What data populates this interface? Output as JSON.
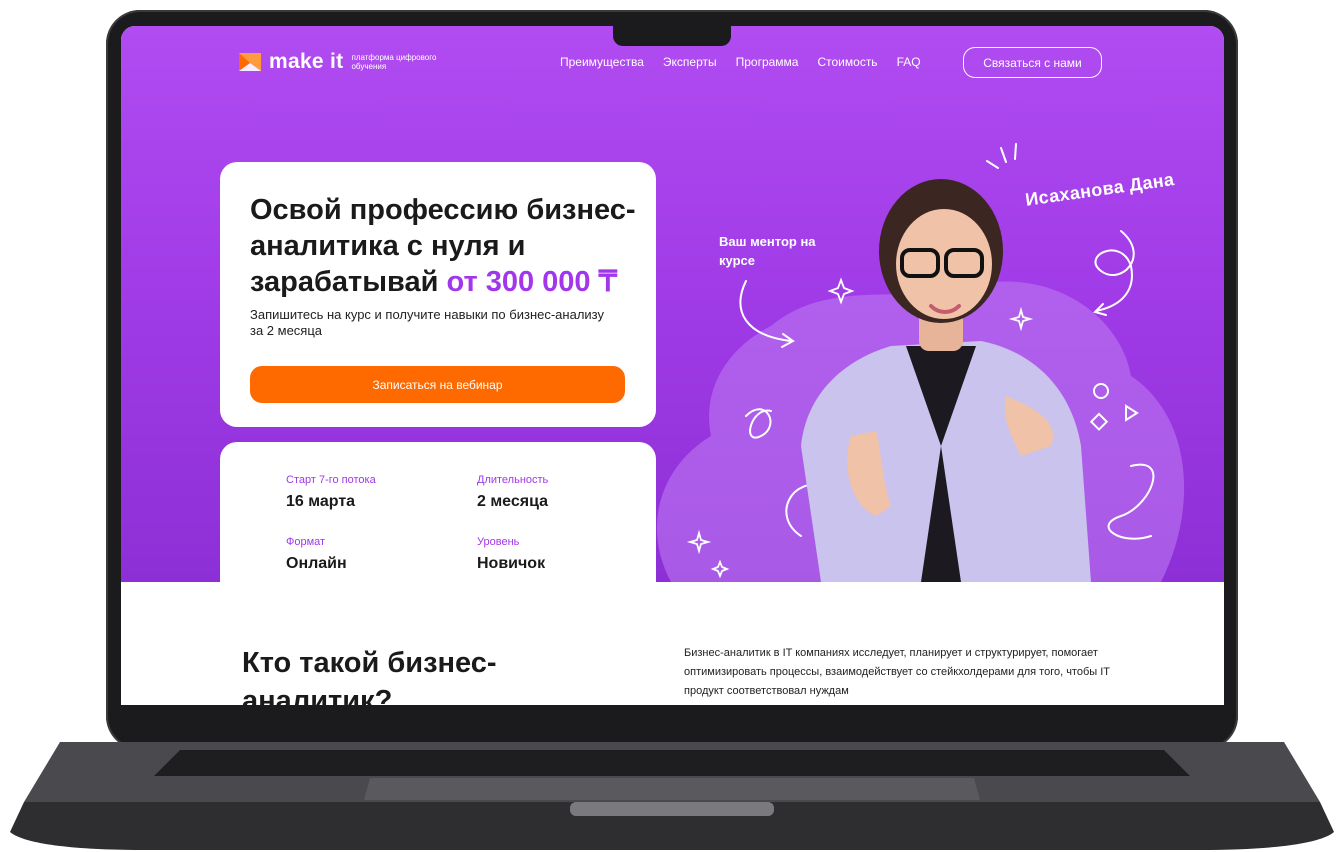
{
  "brand": {
    "name": "make it",
    "tagline": "платформа цифрового обучения",
    "logo_color": "#ff6a00"
  },
  "nav": {
    "items": [
      {
        "label": "Преимущества"
      },
      {
        "label": "Эксперты"
      },
      {
        "label": "Программа"
      },
      {
        "label": "Стоимость"
      },
      {
        "label": "FAQ"
      }
    ],
    "contact_button": "Связаться с нами"
  },
  "hero": {
    "title_main": "Освой профессию бизнес-аналитика с нуля и зарабатывай",
    "title_accent": "от 300 000 ₸",
    "subtitle": "Запишитесь на курс и получите навыки по бизнес-анализу за 2 месяца",
    "cta": "Записаться на вебинар",
    "accent_color": "#a236eb",
    "cta_color": "#ff6a00",
    "background_color": "#a13ce8"
  },
  "course_info": {
    "start_label": "Старт 7-го потока",
    "start_value": "16 марта",
    "duration_label": "Длительность",
    "duration_value": "2 месяца",
    "format_label": "Формат",
    "format_value": "Онлайн",
    "level_label": "Уровень",
    "level_value": "Новичок"
  },
  "mentor": {
    "label": "Ваш ментор на курсе",
    "name": "Исаханова Дана"
  },
  "about": {
    "title": "Кто такой бизнес-аналитик?",
    "text": "Бизнес-аналитик в IT компаниях исследует, планирует и структурирует, помогает оптимизировать процессы,  взаимодействует со стейкхолдерами для того, чтобы IT продукт соответствовал нуждам"
  }
}
